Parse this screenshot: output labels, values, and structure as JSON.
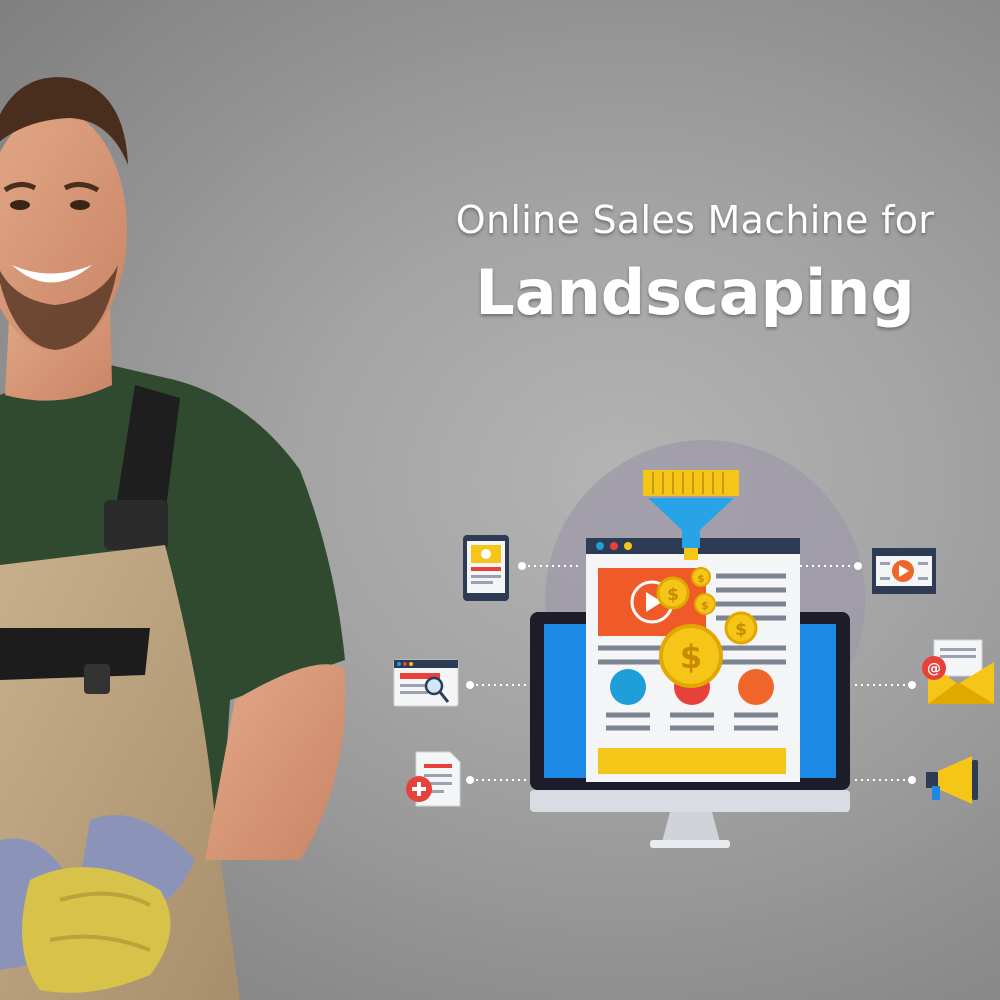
{
  "banner": {
    "subtitle": "Online Sales Machine for",
    "title": "Landscaping"
  },
  "illustration": {
    "central_graphic": "sales-funnel-monitor",
    "left_icons": [
      "mobile-page-icon",
      "web-search-icon",
      "add-document-icon"
    ],
    "right_icons": [
      "video-player-icon",
      "email-icon",
      "megaphone-icon"
    ],
    "colors": {
      "monitor_screen": "#1e88e5",
      "funnel": "#29a3e8",
      "coin": "#f5c518",
      "card_orange": "#f05a28",
      "dot_blue": "#1e9fd8",
      "dot_red": "#e8403b",
      "dot_orange": "#f0652a"
    }
  },
  "photo": {
    "subject": "smiling landscaper in overalls and work gloves"
  }
}
